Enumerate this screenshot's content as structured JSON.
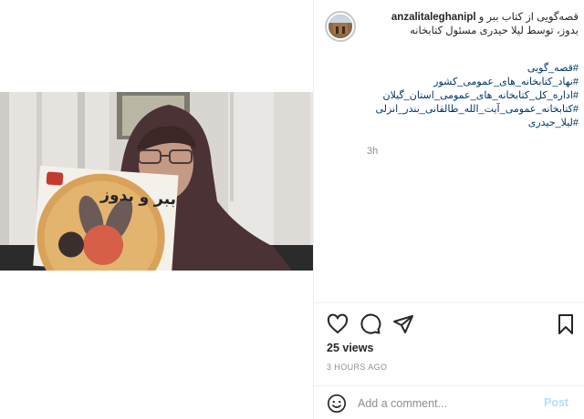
{
  "post": {
    "username": "anzalitaleghanipl",
    "caption_line1": "قصه‌گویی از کتاب ببر و",
    "caption_line2": "بدوز، توسط لیلا حیدری مسئول کتابخانه",
    "hashtags": [
      "#قصه_گویی",
      "#نهاد_کتابخانه_های_عمومی_کشور",
      "#اداره_کل_کتابخانه_های_عمومی_استان_گیلان",
      "#کتابخانه_عمومی_آیت_الله_طالقانی_بندر_انزلی",
      "#لیلا_حیدری"
    ],
    "time_ago": "3h",
    "views": "25 views",
    "timestamp": "3 HOURS AGO"
  },
  "video": {
    "book_title": "ببر و بدوز"
  },
  "comment": {
    "placeholder": "Add a comment...",
    "post_label": "Post"
  },
  "icons": {
    "like": "heart-icon",
    "comment": "comment-bubble-icon",
    "share": "paper-plane-icon",
    "save": "bookmark-icon",
    "emoji": "smiley-icon"
  }
}
